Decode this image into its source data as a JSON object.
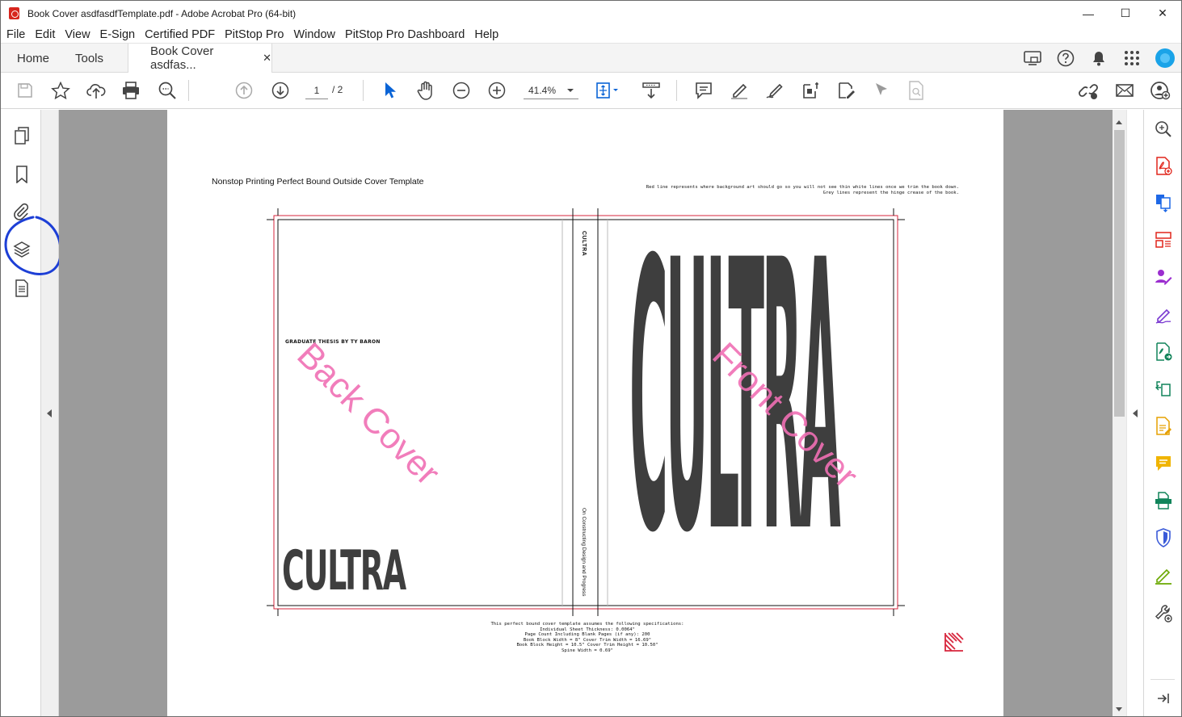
{
  "window": {
    "title": "Book Cover asdfasdfTemplate.pdf - Adobe Acrobat Pro (64-bit)",
    "controls": {
      "minimize": "—",
      "maximize": "☐",
      "close": "✕"
    }
  },
  "menu": [
    "File",
    "Edit",
    "View",
    "E-Sign",
    "Certified PDF",
    "PitStop Pro",
    "Window",
    "PitStop Pro Dashboard",
    "Help"
  ],
  "tabs": {
    "home": "Home",
    "tools": "Tools",
    "doc": "Book Cover asdfas...",
    "close": "✕"
  },
  "toolbar": {
    "page_current": "1",
    "page_total": "/ 2",
    "zoom": "41.4%"
  },
  "pdf": {
    "heading": "Nonstop Printing Perfect Bound Outside Cover Template",
    "note_line1": "Red line represents where background art should go so you will not see thin white lines once we trim the book down.",
    "note_line2": "Grey lines represent the hinge crease of the book.",
    "back_label": "GRADUATE THESIS BY TY BARON",
    "back_title": "CULTRA",
    "spine_title": "CULTRA",
    "spine_subtitle": "On Constructing Design and Progress",
    "front_title": "CULTRA",
    "watermark_back": "Back Cover",
    "watermark_front": "Front Cover",
    "specs": [
      "This perfect bound cover template assumes the following specifications:",
      "Individual Sheet Thickness: 0.0064\"",
      "Page Count Including Blank Pages (if any): 200",
      "Book Block Width = 8\"   Cover Trim Width = 16.69\"",
      "Book Block Height = 10.5\"   Cover Trim Height = 10.50\"",
      "Spine Width = 0.69\""
    ]
  },
  "colors": {
    "accent_blue": "#0a64d6",
    "trim_red": "#d7263d",
    "watermark_pink": "#f06fb4",
    "annotation_blue": "#1d3fd6"
  }
}
